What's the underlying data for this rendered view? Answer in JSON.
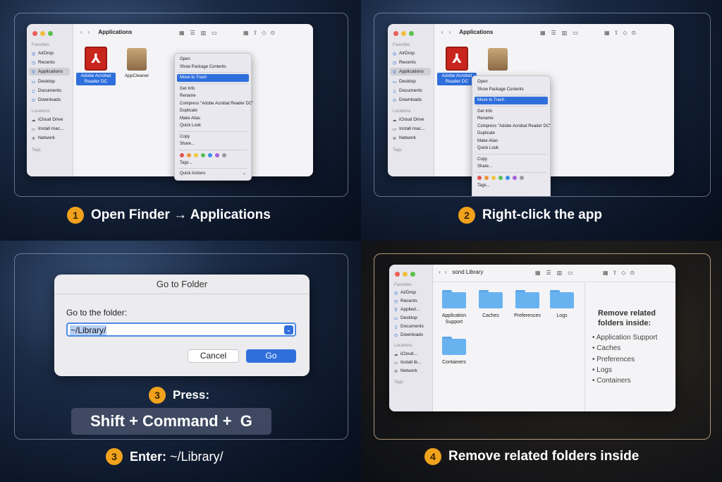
{
  "finder": {
    "sidebar_favorites": "Favorites",
    "sidebar_items": [
      "AirDrop",
      "Recents",
      "Applications",
      "Desktop",
      "Documents",
      "Downloads"
    ],
    "sidebar_locations": "Locations",
    "location_items": [
      "iCloud Drive",
      "Install mac...",
      "Network"
    ],
    "location_items_short": [
      "iCloud...",
      "Install ib...",
      "Network"
    ],
    "sidebar_tags": "Tags",
    "applied_short": "Applied...",
    "title_apps": "Applications",
    "title_library": "sond Library",
    "app1_line1": "Adobe Acrobat",
    "app1_line2": "Reader DC",
    "app2": "AppCleaner"
  },
  "context_menu": {
    "items": [
      "Open",
      "Show Package Contents",
      "Move to Trash",
      "Get Info",
      "Rename",
      "Compress \"Adobe Acrobat Reader DC\"",
      "Duplicate",
      "Make Alias",
      "Quick Look",
      "Copy",
      "Share...",
      "Tags...",
      "Quick Actions"
    ]
  },
  "colors": {
    "tag_dots": [
      "#e4534c",
      "#f0943a",
      "#efc93b",
      "#58bf57",
      "#3b8fe8",
      "#a463d8",
      "#9a9aa0"
    ],
    "accent": "#2f6fdc",
    "badge": "#f0a21c"
  },
  "goto": {
    "title": "Go to Folder",
    "label": "Go to the folder:",
    "value": "~/Library/",
    "cancel": "Cancel",
    "go": "Go"
  },
  "library": {
    "folders": [
      "Application Support",
      "Caches",
      "Preferences",
      "Logs",
      "Containers"
    ],
    "panel_title_1": "Remove related",
    "panel_title_2": "folders inside:",
    "panel_items": [
      "Application Support",
      "Caches",
      "Preferences",
      "Logs",
      "Containers"
    ]
  },
  "steps": {
    "s1_num": "1",
    "s1": "Open Finder → Applications",
    "s2_num": "2",
    "s2": "Right-click the app",
    "s3_num": "3",
    "s3": "Press:",
    "keys": "Shift + Command +  G",
    "s3b_num": "3",
    "s3b_prefix": "Enter:",
    "s3b_value": "~/Library/",
    "s4_num": "4",
    "s4": "Remove related folders inside"
  }
}
